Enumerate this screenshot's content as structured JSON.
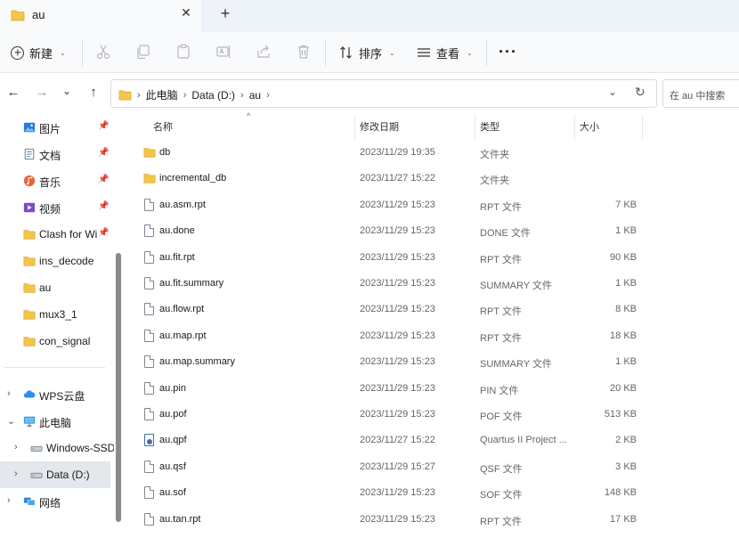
{
  "window": {
    "tab_title": "au",
    "close_glyph": "✕",
    "new_tab_glyph": "+"
  },
  "toolbar": {
    "new_label": "新建",
    "sort_label": "排序",
    "view_label": "查看",
    "more_glyph": "···",
    "caret": "⌄",
    "icons": [
      "cut-icon",
      "copy-icon",
      "paste-icon",
      "rename-icon",
      "share-icon",
      "delete-icon"
    ]
  },
  "nav": {
    "back": "←",
    "forward": "→",
    "recent": "⌄",
    "up": "↑"
  },
  "address": {
    "crumbs": [
      "此电脑",
      "Data (D:)",
      "au"
    ],
    "sep": "›",
    "dropdown": "⌄",
    "refresh": "↻"
  },
  "search": {
    "placeholder": "在 au 中搜索"
  },
  "sidebar": {
    "pin_glyph": "📌",
    "quick_access": [
      {
        "label": "图片",
        "icon": "pictures-icon"
      },
      {
        "label": "文档",
        "icon": "documents-icon"
      },
      {
        "label": "音乐",
        "icon": "music-icon"
      },
      {
        "label": "视频",
        "icon": "videos-icon"
      },
      {
        "label": "Clash for Wi",
        "icon": "folder-icon"
      },
      {
        "label": "ins_decode",
        "icon": "folder-icon"
      },
      {
        "label": "au",
        "icon": "folder-icon"
      },
      {
        "label": "mux3_1",
        "icon": "folder-icon"
      },
      {
        "label": "con_signal",
        "icon": "folder-icon"
      }
    ],
    "tree": [
      {
        "label": "WPS云盘",
        "icon": "cloud-icon",
        "expander": "›"
      },
      {
        "label": "此电脑",
        "icon": "pc-icon",
        "expander": "⌄"
      },
      {
        "label": "Windows-SSD",
        "icon": "drive-icon",
        "expander": "›"
      },
      {
        "label": "Data (D:)",
        "icon": "drive-icon",
        "expander": "›"
      },
      {
        "label": "网络",
        "icon": "network-icon",
        "expander": "›"
      }
    ]
  },
  "columns": {
    "name": "名称",
    "date": "修改日期",
    "type": "类型",
    "size": "大小",
    "sort_arrow": "^"
  },
  "files": [
    {
      "name": "db",
      "date": "2023/11/29 19:35",
      "type": "文件夹",
      "size": "",
      "kind": "folder"
    },
    {
      "name": "incremental_db",
      "date": "2023/11/27 15:22",
      "type": "文件夹",
      "size": "",
      "kind": "folder"
    },
    {
      "name": "au.asm.rpt",
      "date": "2023/11/29 15:23",
      "type": "RPT 文件",
      "size": "7 KB",
      "kind": "file"
    },
    {
      "name": "au.done",
      "date": "2023/11/29 15:23",
      "type": "DONE 文件",
      "size": "1 KB",
      "kind": "file"
    },
    {
      "name": "au.fit.rpt",
      "date": "2023/11/29 15:23",
      "type": "RPT 文件",
      "size": "90 KB",
      "kind": "file"
    },
    {
      "name": "au.fit.summary",
      "date": "2023/11/29 15:23",
      "type": "SUMMARY 文件",
      "size": "1 KB",
      "kind": "file"
    },
    {
      "name": "au.flow.rpt",
      "date": "2023/11/29 15:23",
      "type": "RPT 文件",
      "size": "8 KB",
      "kind": "file"
    },
    {
      "name": "au.map.rpt",
      "date": "2023/11/29 15:23",
      "type": "RPT 文件",
      "size": "18 KB",
      "kind": "file"
    },
    {
      "name": "au.map.summary",
      "date": "2023/11/29 15:23",
      "type": "SUMMARY 文件",
      "size": "1 KB",
      "kind": "file"
    },
    {
      "name": "au.pin",
      "date": "2023/11/29 15:23",
      "type": "PIN 文件",
      "size": "20 KB",
      "kind": "file"
    },
    {
      "name": "au.pof",
      "date": "2023/11/29 15:23",
      "type": "POF 文件",
      "size": "513 KB",
      "kind": "file"
    },
    {
      "name": "au.qpf",
      "date": "2023/11/27 15:22",
      "type": "Quartus II Project ...",
      "size": "2 KB",
      "kind": "qpf"
    },
    {
      "name": "au.qsf",
      "date": "2023/11/29 15:27",
      "type": "QSF 文件",
      "size": "3 KB",
      "kind": "file"
    },
    {
      "name": "au.sof",
      "date": "2023/11/29 15:23",
      "type": "SOF 文件",
      "size": "148 KB",
      "kind": "file"
    },
    {
      "name": "au.tan.rpt",
      "date": "2023/11/29 15:23",
      "type": "RPT 文件",
      "size": "17 KB",
      "kind": "file"
    }
  ],
  "colors": {
    "folder": "#f2c54b",
    "folder_dark": "#e0a922",
    "selected": "#e4e7ec"
  }
}
